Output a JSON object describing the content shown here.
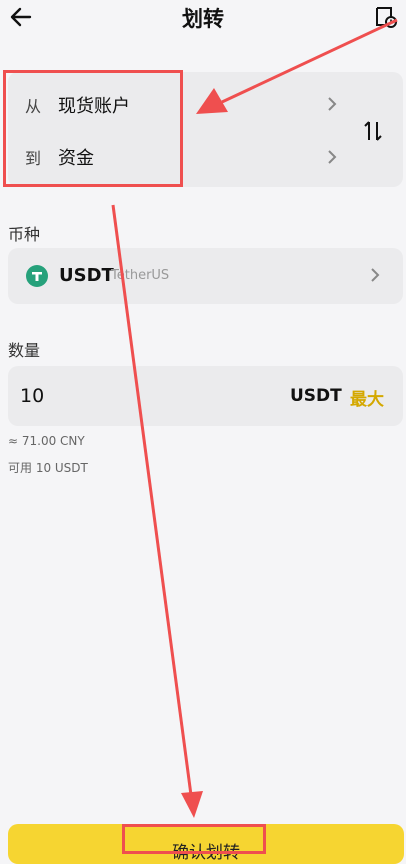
{
  "header": {
    "title": "划转",
    "back_icon": "arrow-left-icon",
    "history_icon": "transfer-history-icon"
  },
  "transfer": {
    "from_label": "从",
    "from_value": "现货账户",
    "to_label": "到",
    "to_value": "资金",
    "swap_icon": "swap-vertical-icon"
  },
  "coin": {
    "section_label": "币种",
    "code": "USDT",
    "name": "TetherUS",
    "icon": "tether-icon",
    "icon_color": "#26a17b"
  },
  "quantity": {
    "section_label": "数量",
    "value": "10",
    "unit": "USDT",
    "max_label": "最大",
    "cny_value": "≈ 71.00 CNY",
    "available": "可用 10 USDT"
  },
  "confirm": {
    "label": "确认划转"
  },
  "colors": {
    "accent": "#f6d531",
    "annotation": "#ef4f4f",
    "max": "#d4a800"
  }
}
